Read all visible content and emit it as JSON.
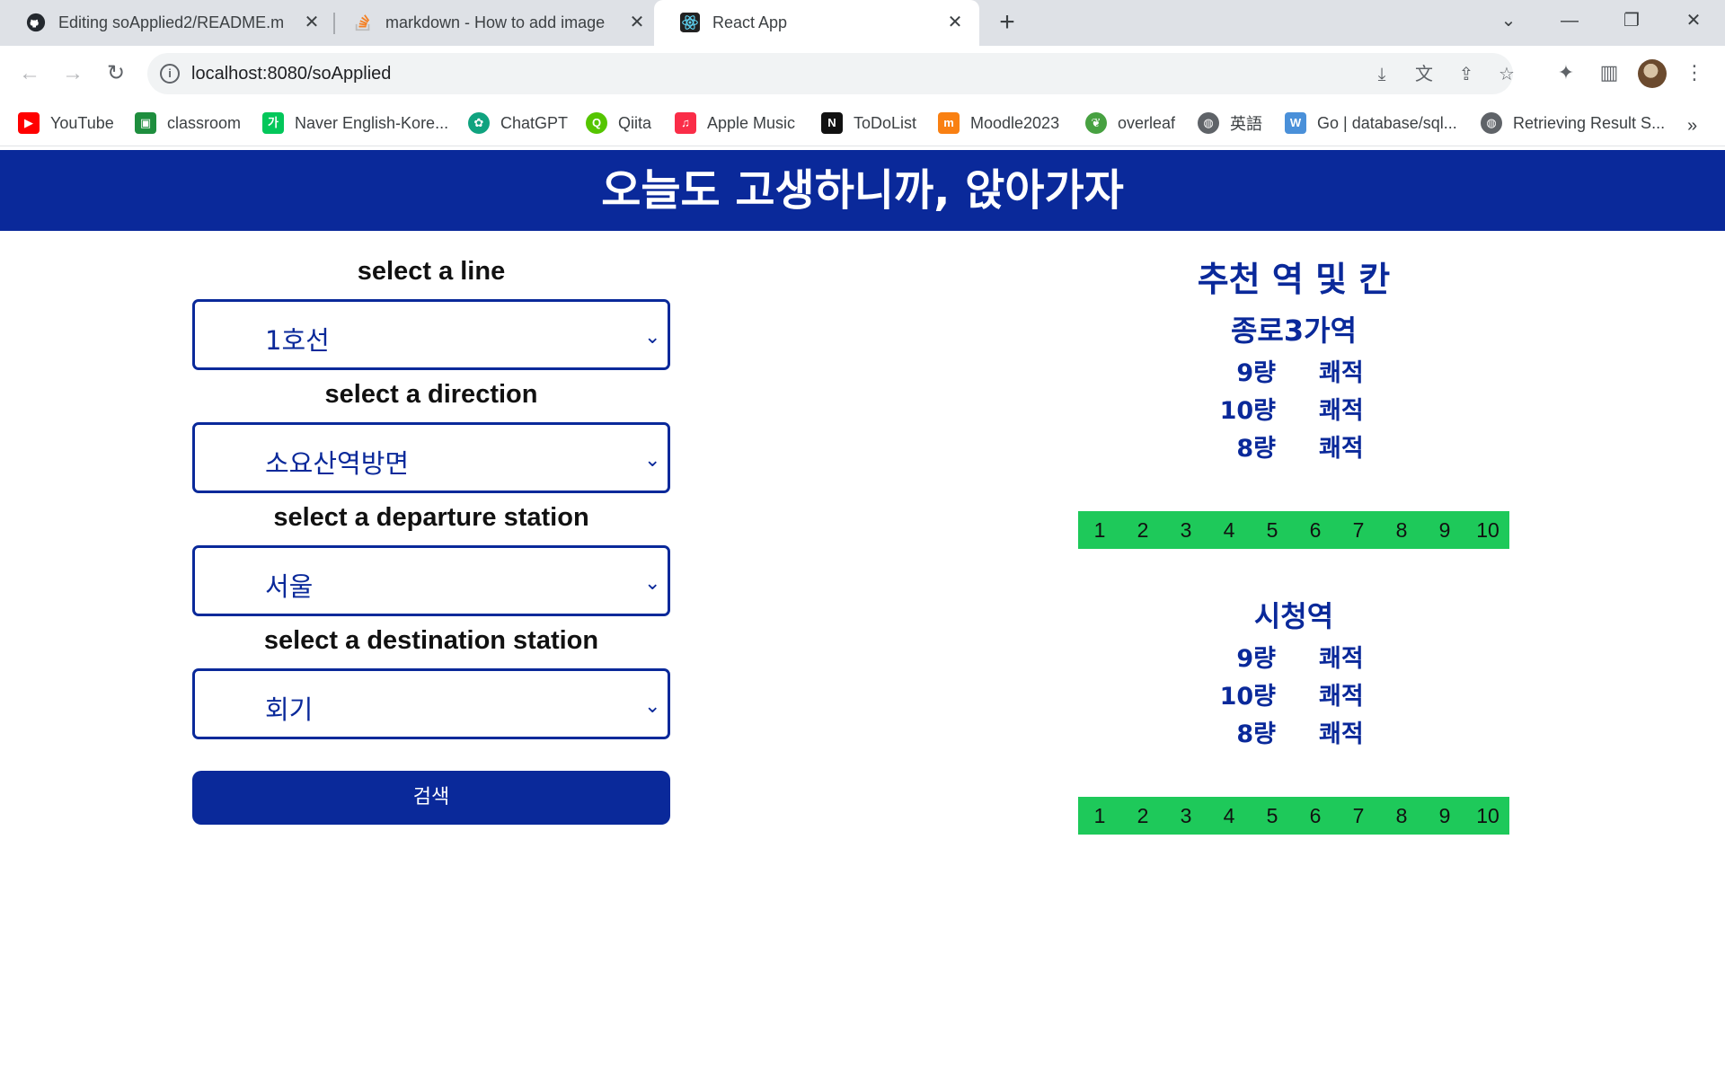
{
  "browser": {
    "tabs": [
      {
        "title": "Editing soApplied2/README.m",
        "favicon": "github-icon"
      },
      {
        "title": "markdown - How to add image",
        "favicon": "stackoverflow-icon"
      },
      {
        "title": "React App",
        "favicon": "react-icon",
        "active": true
      }
    ],
    "url": "localhost:8080/soApplied",
    "bookmarks": [
      {
        "label": "YouTube",
        "icon": "youtube-icon",
        "color": "#ff0000"
      },
      {
        "label": "classroom",
        "icon": "classroom-icon",
        "color": "#1e8e3e"
      },
      {
        "label": "Naver English-Kore...",
        "icon": "naver-icon",
        "color": "#03c75a"
      },
      {
        "label": "ChatGPT",
        "icon": "chatgpt-icon",
        "color": "#10a37f"
      },
      {
        "label": "Qiita",
        "icon": "qiita-icon",
        "color": "#55c500"
      },
      {
        "label": "Apple Music",
        "icon": "apple-music-icon",
        "color": "#fa2d48"
      },
      {
        "label": "ToDoList",
        "icon": "notion-icon",
        "color": "#111111"
      },
      {
        "label": "Moodle2023",
        "icon": "moodle-icon",
        "color": "#f98012"
      },
      {
        "label": "overleaf",
        "icon": "overleaf-icon",
        "color": "#47a141"
      },
      {
        "label": "英語",
        "icon": "globe-icon",
        "color": "#5f6368"
      },
      {
        "label": "Go | database/sql...",
        "icon": "wk-icon",
        "color": "#4a90d9"
      },
      {
        "label": "Retrieving Result S...",
        "icon": "globe-icon",
        "color": "#5f6368"
      }
    ]
  },
  "page": {
    "banner": "오늘도 고생하니까, 앉아가자",
    "form": {
      "line_label": "select a line",
      "line_value": "1호선",
      "direction_label": "select a direction",
      "direction_value": "소요산역방면",
      "departure_label": "select a departure station",
      "departure_value": "서울",
      "destination_label": "select a destination station",
      "destination_value": "회기",
      "search_button": "검색"
    },
    "recommendation": {
      "title": "추천 역 및 칸",
      "stations": [
        {
          "name": "종로3가역",
          "cars": [
            {
              "car": "9량",
              "status": "쾌적"
            },
            {
              "car": "10량",
              "status": "쾌적"
            },
            {
              "car": "8량",
              "status": "쾌적"
            }
          ],
          "train_cars": [
            "1",
            "2",
            "3",
            "4",
            "5",
            "6",
            "7",
            "8",
            "9",
            "10"
          ]
        },
        {
          "name": "시청역",
          "cars": [
            {
              "car": "9량",
              "status": "쾌적"
            },
            {
              "car": "10량",
              "status": "쾌적"
            },
            {
              "car": "8량",
              "status": "쾌적"
            }
          ],
          "train_cars": [
            "1",
            "2",
            "3",
            "4",
            "5",
            "6",
            "7",
            "8",
            "9",
            "10"
          ]
        }
      ]
    }
  },
  "colors": {
    "accent": "#0a299a",
    "train": "#1ec95a"
  }
}
